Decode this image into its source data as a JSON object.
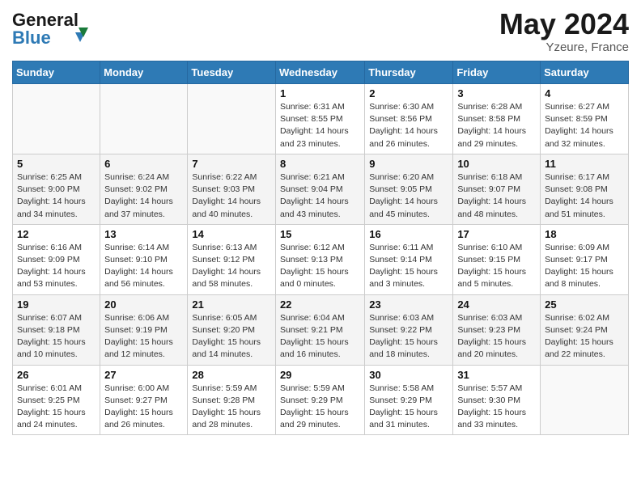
{
  "header": {
    "logo_line1": "General",
    "logo_line2": "Blue",
    "month": "May 2024",
    "location": "Yzeure, France"
  },
  "days_of_week": [
    "Sunday",
    "Monday",
    "Tuesday",
    "Wednesday",
    "Thursday",
    "Friday",
    "Saturday"
  ],
  "weeks": [
    [
      {
        "day": "",
        "info": []
      },
      {
        "day": "",
        "info": []
      },
      {
        "day": "",
        "info": []
      },
      {
        "day": "1",
        "info": [
          "Sunrise: 6:31 AM",
          "Sunset: 8:55 PM",
          "Daylight: 14 hours",
          "and 23 minutes."
        ]
      },
      {
        "day": "2",
        "info": [
          "Sunrise: 6:30 AM",
          "Sunset: 8:56 PM",
          "Daylight: 14 hours",
          "and 26 minutes."
        ]
      },
      {
        "day": "3",
        "info": [
          "Sunrise: 6:28 AM",
          "Sunset: 8:58 PM",
          "Daylight: 14 hours",
          "and 29 minutes."
        ]
      },
      {
        "day": "4",
        "info": [
          "Sunrise: 6:27 AM",
          "Sunset: 8:59 PM",
          "Daylight: 14 hours",
          "and 32 minutes."
        ]
      }
    ],
    [
      {
        "day": "5",
        "info": [
          "Sunrise: 6:25 AM",
          "Sunset: 9:00 PM",
          "Daylight: 14 hours",
          "and 34 minutes."
        ]
      },
      {
        "day": "6",
        "info": [
          "Sunrise: 6:24 AM",
          "Sunset: 9:02 PM",
          "Daylight: 14 hours",
          "and 37 minutes."
        ]
      },
      {
        "day": "7",
        "info": [
          "Sunrise: 6:22 AM",
          "Sunset: 9:03 PM",
          "Daylight: 14 hours",
          "and 40 minutes."
        ]
      },
      {
        "day": "8",
        "info": [
          "Sunrise: 6:21 AM",
          "Sunset: 9:04 PM",
          "Daylight: 14 hours",
          "and 43 minutes."
        ]
      },
      {
        "day": "9",
        "info": [
          "Sunrise: 6:20 AM",
          "Sunset: 9:05 PM",
          "Daylight: 14 hours",
          "and 45 minutes."
        ]
      },
      {
        "day": "10",
        "info": [
          "Sunrise: 6:18 AM",
          "Sunset: 9:07 PM",
          "Daylight: 14 hours",
          "and 48 minutes."
        ]
      },
      {
        "day": "11",
        "info": [
          "Sunrise: 6:17 AM",
          "Sunset: 9:08 PM",
          "Daylight: 14 hours",
          "and 51 minutes."
        ]
      }
    ],
    [
      {
        "day": "12",
        "info": [
          "Sunrise: 6:16 AM",
          "Sunset: 9:09 PM",
          "Daylight: 14 hours",
          "and 53 minutes."
        ]
      },
      {
        "day": "13",
        "info": [
          "Sunrise: 6:14 AM",
          "Sunset: 9:10 PM",
          "Daylight: 14 hours",
          "and 56 minutes."
        ]
      },
      {
        "day": "14",
        "info": [
          "Sunrise: 6:13 AM",
          "Sunset: 9:12 PM",
          "Daylight: 14 hours",
          "and 58 minutes."
        ]
      },
      {
        "day": "15",
        "info": [
          "Sunrise: 6:12 AM",
          "Sunset: 9:13 PM",
          "Daylight: 15 hours",
          "and 0 minutes."
        ]
      },
      {
        "day": "16",
        "info": [
          "Sunrise: 6:11 AM",
          "Sunset: 9:14 PM",
          "Daylight: 15 hours",
          "and 3 minutes."
        ]
      },
      {
        "day": "17",
        "info": [
          "Sunrise: 6:10 AM",
          "Sunset: 9:15 PM",
          "Daylight: 15 hours",
          "and 5 minutes."
        ]
      },
      {
        "day": "18",
        "info": [
          "Sunrise: 6:09 AM",
          "Sunset: 9:17 PM",
          "Daylight: 15 hours",
          "and 8 minutes."
        ]
      }
    ],
    [
      {
        "day": "19",
        "info": [
          "Sunrise: 6:07 AM",
          "Sunset: 9:18 PM",
          "Daylight: 15 hours",
          "and 10 minutes."
        ]
      },
      {
        "day": "20",
        "info": [
          "Sunrise: 6:06 AM",
          "Sunset: 9:19 PM",
          "Daylight: 15 hours",
          "and 12 minutes."
        ]
      },
      {
        "day": "21",
        "info": [
          "Sunrise: 6:05 AM",
          "Sunset: 9:20 PM",
          "Daylight: 15 hours",
          "and 14 minutes."
        ]
      },
      {
        "day": "22",
        "info": [
          "Sunrise: 6:04 AM",
          "Sunset: 9:21 PM",
          "Daylight: 15 hours",
          "and 16 minutes."
        ]
      },
      {
        "day": "23",
        "info": [
          "Sunrise: 6:03 AM",
          "Sunset: 9:22 PM",
          "Daylight: 15 hours",
          "and 18 minutes."
        ]
      },
      {
        "day": "24",
        "info": [
          "Sunrise: 6:03 AM",
          "Sunset: 9:23 PM",
          "Daylight: 15 hours",
          "and 20 minutes."
        ]
      },
      {
        "day": "25",
        "info": [
          "Sunrise: 6:02 AM",
          "Sunset: 9:24 PM",
          "Daylight: 15 hours",
          "and 22 minutes."
        ]
      }
    ],
    [
      {
        "day": "26",
        "info": [
          "Sunrise: 6:01 AM",
          "Sunset: 9:25 PM",
          "Daylight: 15 hours",
          "and 24 minutes."
        ]
      },
      {
        "day": "27",
        "info": [
          "Sunrise: 6:00 AM",
          "Sunset: 9:27 PM",
          "Daylight: 15 hours",
          "and 26 minutes."
        ]
      },
      {
        "day": "28",
        "info": [
          "Sunrise: 5:59 AM",
          "Sunset: 9:28 PM",
          "Daylight: 15 hours",
          "and 28 minutes."
        ]
      },
      {
        "day": "29",
        "info": [
          "Sunrise: 5:59 AM",
          "Sunset: 9:29 PM",
          "Daylight: 15 hours",
          "and 29 minutes."
        ]
      },
      {
        "day": "30",
        "info": [
          "Sunrise: 5:58 AM",
          "Sunset: 9:29 PM",
          "Daylight: 15 hours",
          "and 31 minutes."
        ]
      },
      {
        "day": "31",
        "info": [
          "Sunrise: 5:57 AM",
          "Sunset: 9:30 PM",
          "Daylight: 15 hours",
          "and 33 minutes."
        ]
      },
      {
        "day": "",
        "info": []
      }
    ]
  ]
}
